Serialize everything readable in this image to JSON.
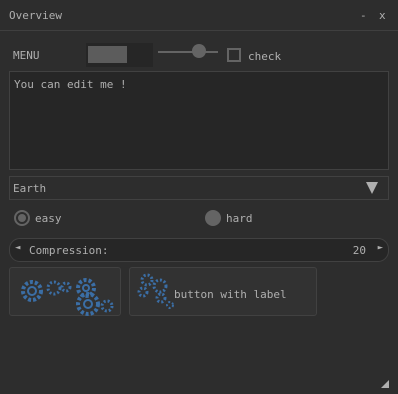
{
  "window": {
    "title": "Overview",
    "minimize": "-",
    "close": "x"
  },
  "menu": {
    "label": "MENU"
  },
  "slider": {
    "value": 0.6
  },
  "checkbox": {
    "label": "check",
    "checked": false
  },
  "editor": {
    "text": "You can edit me !"
  },
  "combo": {
    "selected": "Earth"
  },
  "radios": [
    {
      "label": "easy",
      "selected": true
    },
    {
      "label": "hard",
      "selected": false
    }
  ],
  "property": {
    "label": "Compression:",
    "value": "20",
    "left_arrow": "◄",
    "right_arrow": "►"
  },
  "buttons": [
    {
      "icon": "gears-icon"
    },
    {
      "icon": "gears-icon",
      "label": "button with label"
    }
  ],
  "colors": {
    "background": "#2d2d2d",
    "widget": "#646464",
    "text": "#afafaf",
    "icon": "#3b6ea5"
  }
}
